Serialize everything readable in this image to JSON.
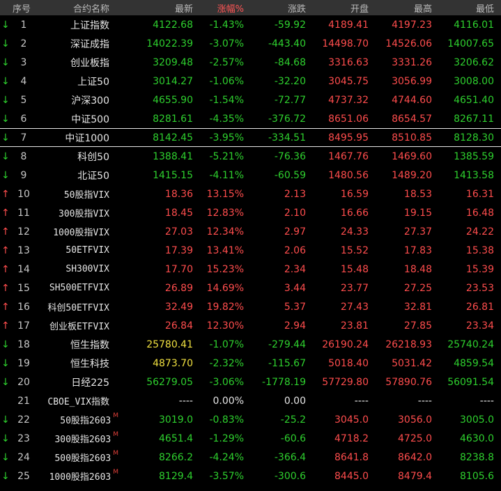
{
  "header": {
    "idx": "序号",
    "name": "合约名称",
    "last": "最新",
    "pct": "涨幅%",
    "chg": "涨跌",
    "open": "开盘",
    "high": "最高",
    "low": "最低"
  },
  "rows": [
    {
      "idx": "1",
      "name": "上证指数",
      "dir": "down",
      "last": "4122.68",
      "pct": "-1.43%",
      "chg": "-59.92",
      "open": "4189.41",
      "high": "4197.23",
      "low": "4116.01"
    },
    {
      "idx": "2",
      "name": "深证成指",
      "dir": "down",
      "last": "14022.39",
      "pct": "-3.07%",
      "chg": "-443.40",
      "open": "14498.70",
      "high": "14526.06",
      "low": "14007.65"
    },
    {
      "idx": "3",
      "name": "创业板指",
      "dir": "down",
      "last": "3209.48",
      "pct": "-2.57%",
      "chg": "-84.68",
      "open": "3316.63",
      "high": "3331.26",
      "low": "3206.62"
    },
    {
      "idx": "4",
      "name": "上证50",
      "dir": "down",
      "last": "3014.27",
      "pct": "-1.06%",
      "chg": "-32.20",
      "open": "3045.75",
      "high": "3056.99",
      "low": "3008.00"
    },
    {
      "idx": "5",
      "name": "沪深300",
      "dir": "down",
      "last": "4655.90",
      "pct": "-1.54%",
      "chg": "-72.77",
      "open": "4737.32",
      "high": "4744.60",
      "low": "4651.40"
    },
    {
      "idx": "6",
      "name": "中证500",
      "dir": "down",
      "last": "8281.61",
      "pct": "-4.35%",
      "chg": "-376.72",
      "open": "8651.06",
      "high": "8654.57",
      "low": "8267.11"
    },
    {
      "idx": "7",
      "name": "中证1000",
      "dir": "down",
      "last": "8142.45",
      "pct": "-3.95%",
      "chg": "-334.51",
      "open": "8495.95",
      "high": "8510.85",
      "low": "8128.30",
      "selected": true
    },
    {
      "idx": "8",
      "name": "科创50",
      "dir": "down",
      "last": "1388.41",
      "pct": "-5.21%",
      "chg": "-76.36",
      "open": "1467.76",
      "high": "1469.60",
      "low": "1385.59"
    },
    {
      "idx": "9",
      "name": "北证50",
      "dir": "down",
      "last": "1415.15",
      "pct": "-4.11%",
      "chg": "-60.59",
      "open": "1480.56",
      "high": "1489.20",
      "low": "1413.58"
    },
    {
      "idx": "10",
      "name": "50股指VIX",
      "dir": "up",
      "last": "18.36",
      "pct": "13.15%",
      "chg": "2.13",
      "open": "16.59",
      "high": "18.53",
      "low": "16.31"
    },
    {
      "idx": "11",
      "name": "300股指VIX",
      "dir": "up",
      "last": "18.45",
      "pct": "12.83%",
      "chg": "2.10",
      "open": "16.66",
      "high": "19.15",
      "low": "16.48"
    },
    {
      "idx": "12",
      "name": "1000股指VIX",
      "dir": "up",
      "last": "27.03",
      "pct": "12.34%",
      "chg": "2.97",
      "open": "24.33",
      "high": "27.37",
      "low": "24.22"
    },
    {
      "idx": "13",
      "name": "50ETFVIX",
      "dir": "up",
      "last": "17.39",
      "pct": "13.41%",
      "chg": "2.06",
      "open": "15.52",
      "high": "17.83",
      "low": "15.38"
    },
    {
      "idx": "14",
      "name": "SH300VIX",
      "dir": "up",
      "last": "17.70",
      "pct": "15.23%",
      "chg": "2.34",
      "open": "15.48",
      "high": "18.48",
      "low": "15.39"
    },
    {
      "idx": "15",
      "name": "SH500ETFVIX",
      "dir": "up",
      "last": "26.89",
      "pct": "14.69%",
      "chg": "3.44",
      "open": "23.77",
      "high": "27.25",
      "low": "23.53"
    },
    {
      "idx": "16",
      "name": "科创50ETFVIX",
      "dir": "up",
      "last": "32.49",
      "pct": "19.82%",
      "chg": "5.37",
      "open": "27.43",
      "high": "32.81",
      "low": "26.81"
    },
    {
      "idx": "17",
      "name": "创业板ETFVIX",
      "dir": "up",
      "last": "26.84",
      "pct": "12.30%",
      "chg": "2.94",
      "open": "23.81",
      "high": "27.85",
      "low": "23.34"
    },
    {
      "idx": "18",
      "name": "恒生指数",
      "dir": "down",
      "lastColor": "yellow",
      "last": "25780.41",
      "pct": "-1.07%",
      "chg": "-279.44",
      "open": "26190.24",
      "high": "26218.93",
      "low": "25740.24"
    },
    {
      "idx": "19",
      "name": "恒生科技",
      "dir": "down",
      "lastColor": "yellow",
      "last": "4873.70",
      "pct": "-2.32%",
      "chg": "-115.67",
      "open": "5018.40",
      "high": "5031.42",
      "low": "4859.54"
    },
    {
      "idx": "20",
      "name": "日经225",
      "dir": "down",
      "last": "56279.05",
      "pct": "-3.06%",
      "chg": "-1778.19",
      "open": "57729.80",
      "high": "57890.76",
      "low": "56091.54"
    },
    {
      "idx": "21",
      "name": "CBOE_VIX指数",
      "dir": "none",
      "last": "----",
      "pct": "0.00%",
      "chg": "0.00",
      "open": "----",
      "high": "----",
      "low": "----"
    },
    {
      "idx": "22",
      "name": "50股指2603",
      "sup": "M",
      "dir": "down",
      "last": "3019.0",
      "pct": "-0.83%",
      "chg": "-25.2",
      "open": "3045.0",
      "high": "3056.0",
      "low": "3005.0"
    },
    {
      "idx": "23",
      "name": "300股指2603",
      "sup": "M",
      "dir": "down",
      "last": "4651.4",
      "pct": "-1.29%",
      "chg": "-60.6",
      "open": "4718.2",
      "high": "4725.0",
      "low": "4630.0"
    },
    {
      "idx": "24",
      "name": "500股指2603",
      "sup": "M",
      "dir": "down",
      "last": "8266.2",
      "pct": "-4.24%",
      "chg": "-366.4",
      "open": "8641.8",
      "high": "8642.0",
      "low": "8238.8"
    },
    {
      "idx": "25",
      "name": "1000股指2603",
      "sup": "M",
      "dir": "down",
      "last": "8129.4",
      "pct": "-3.57%",
      "chg": "-300.6",
      "open": "8445.0",
      "high": "8479.4",
      "low": "8105.6"
    }
  ],
  "colors": {
    "up": "#ff4d4d",
    "down": "#2ed02e",
    "yellow": "#f0e040",
    "header_bg": "#333333"
  }
}
